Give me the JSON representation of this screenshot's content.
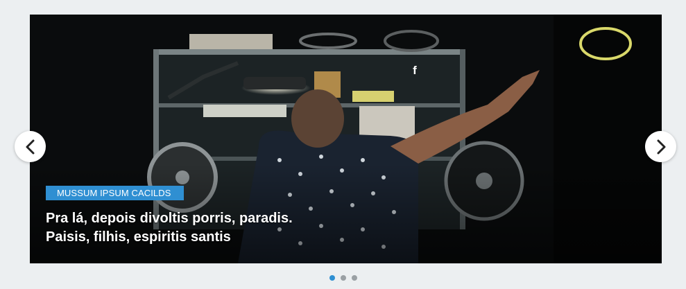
{
  "slider": {
    "category": "MUSSUM IPSUM CACILDS",
    "headline_line1": "Pra lá, depois divoltis porris, paradis.",
    "headline_line2": "Paisis, filhis, espiritis santis",
    "social_icon": "facebook-icon",
    "prev_icon": "chevron-left-icon",
    "next_icon": "chevron-right-icon",
    "dots": [
      {
        "active": true
      },
      {
        "active": false
      },
      {
        "active": false
      }
    ]
  },
  "colors": {
    "accent": "#2f8fd2",
    "background": "#eceff1",
    "dot_inactive": "#9aa0a4"
  }
}
